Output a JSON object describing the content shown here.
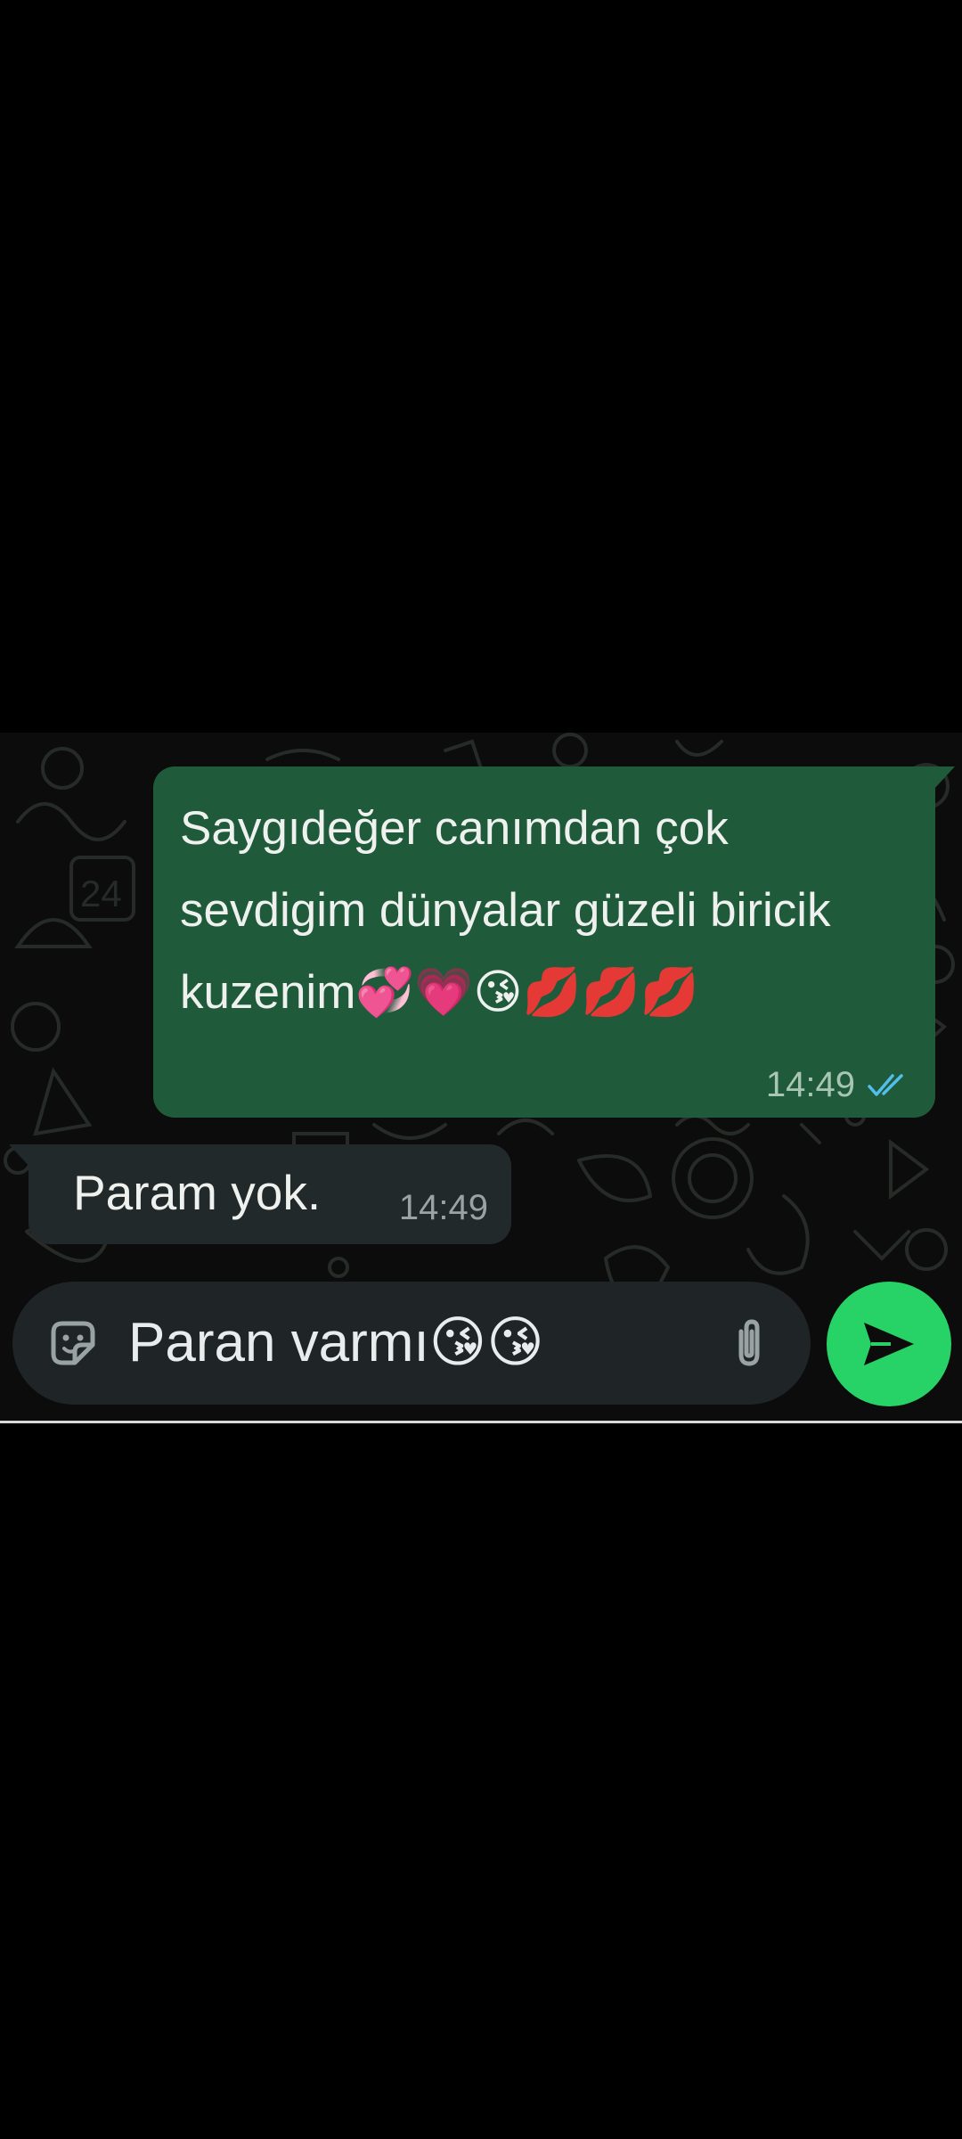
{
  "colors": {
    "outgoing_bubble": "#1f5a3b",
    "incoming_bubble": "#22292a",
    "send_button": "#27d366",
    "read_ticks": "#53bdeb",
    "background": "#0b0c0b"
  },
  "messages": [
    {
      "direction": "outgoing",
      "text": "Saygıdeğer canımdan çok sevdigim dünyalar güzeli biricik kuzenim💞💗😘💋💋💋",
      "time": "14:49",
      "status_icon": "double-check-icon"
    },
    {
      "direction": "incoming",
      "text": "Param yok.",
      "time": "14:49"
    }
  ],
  "composer": {
    "value": "Paran varmı😘😘",
    "left_icon": "sticker-icon",
    "right_icon": "paperclip-icon",
    "send_icon": "send-icon"
  }
}
